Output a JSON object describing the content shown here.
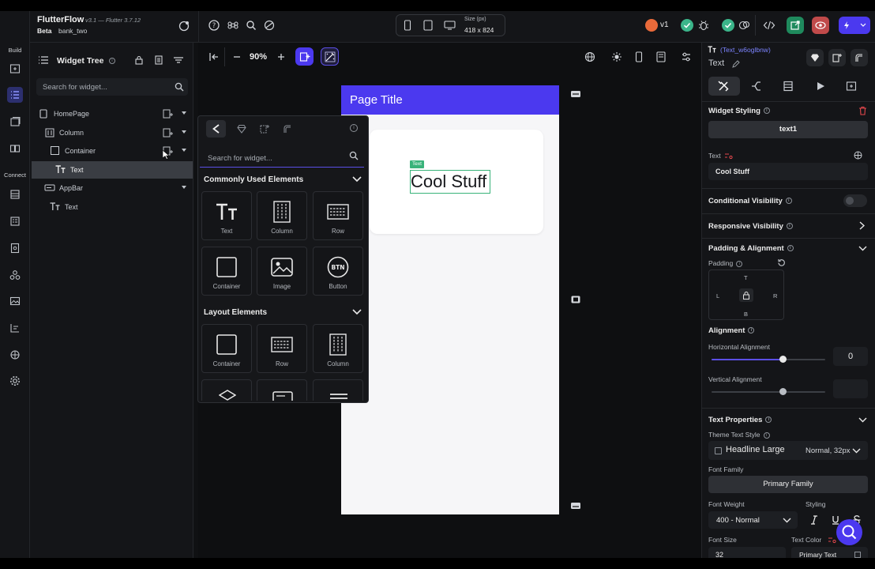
{
  "app": {
    "name": "FlutterFlow",
    "version": "v3.1 — Flutter 3.7.12",
    "channel": "Beta",
    "project": "bank_two"
  },
  "rail": {
    "build_label": "Build",
    "connect_label": "Connect"
  },
  "header": {
    "size_label": "Size (px)",
    "size_value": "418 x 824",
    "version_badge": "v1"
  },
  "widget_tree": {
    "title": "Widget Tree",
    "search_placeholder": "Search for widget...",
    "items": [
      {
        "label": "HomePage"
      },
      {
        "label": "Column"
      },
      {
        "label": "Container"
      },
      {
        "label": "Text"
      },
      {
        "label": "AppBar"
      },
      {
        "label": "Text"
      }
    ]
  },
  "canvas": {
    "zoom": "90%",
    "page_title": "Page Title",
    "text_tag": "Text",
    "text_content": "Cool Stuff"
  },
  "picker": {
    "search_placeholder": "Search for widget...",
    "common_section": "Commonly Used Elements",
    "common_items": [
      {
        "label": "Text",
        "icon": "text-icon"
      },
      {
        "label": "Column",
        "icon": "column-icon"
      },
      {
        "label": "Row",
        "icon": "row-icon"
      },
      {
        "label": "Container",
        "icon": "container-icon"
      },
      {
        "label": "Image",
        "icon": "image-icon"
      },
      {
        "label": "Button",
        "icon": "button-icon",
        "glyph": "BTN"
      }
    ],
    "layout_section": "Layout Elements",
    "layout_items": [
      {
        "label": "Container",
        "icon": "container-icon"
      },
      {
        "label": "Row",
        "icon": "row-icon"
      },
      {
        "label": "Column",
        "icon": "column-icon"
      }
    ]
  },
  "properties": {
    "widget_id": "(Text_w6oglbnw)",
    "widget_type": "Text",
    "widget_styling": "Widget Styling",
    "style_name": "text1",
    "text_label": "Text",
    "text_value": "Cool Stuff",
    "conditional_visibility": "Conditional Visibility",
    "responsive_visibility": "Responsive Visibility",
    "padding_alignment": "Padding & Alignment",
    "padding": "Padding",
    "pad_t": "T",
    "pad_l": "L",
    "pad_r": "R",
    "pad_b": "B",
    "alignment": "Alignment",
    "horizontal_alignment": "Horizontal Alignment",
    "horizontal_value": "0",
    "horizontal_level": 0.5,
    "vertical_alignment": "Vertical Alignment",
    "vertical_value": "",
    "vertical_level": 0.5,
    "text_properties": "Text Properties",
    "theme_text_style": "Theme Text Style",
    "theme_style_value": "Headline Large",
    "theme_style_meta": "Normal, 32px",
    "font_family": "Font Family",
    "font_family_value": "Primary Family",
    "font_weight": "Font Weight",
    "font_weight_value": "400 - Normal",
    "styling": "Styling",
    "font_size": "Font Size",
    "font_size_value": "32",
    "text_color": "Text Color",
    "text_color_value": "Primary Text"
  },
  "colors": {
    "accent": "#4b39ef",
    "selection_green": "#39b37a",
    "danger": "#e5484d"
  }
}
